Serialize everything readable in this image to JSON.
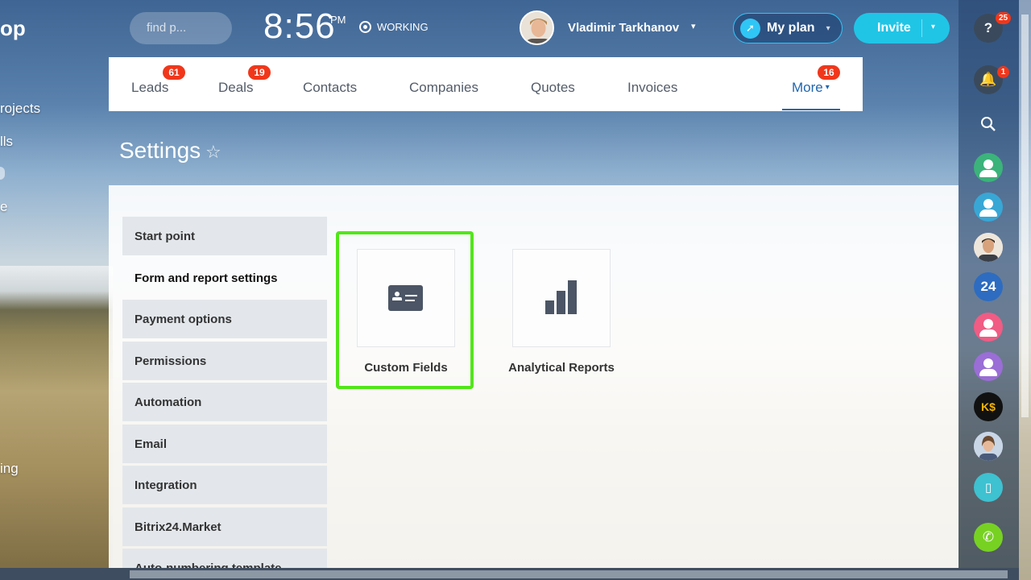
{
  "left_sidebar": {
    "logo_fragment": "op",
    "items": [
      "rojects",
      "lls",
      "e",
      "ing"
    ]
  },
  "header": {
    "search_placeholder": "find p...",
    "time": "8:56",
    "ampm": "PM",
    "status": "WORKING",
    "user_name": "Vladimir Tarkhanov",
    "my_plan_label": "My plan",
    "invite_label": "Invite"
  },
  "tabs": [
    {
      "label": "Leads",
      "badge": "61"
    },
    {
      "label": "Deals",
      "badge": "19"
    },
    {
      "label": "Contacts",
      "badge": ""
    },
    {
      "label": "Companies",
      "badge": ""
    },
    {
      "label": "Quotes",
      "badge": ""
    },
    {
      "label": "Invoices",
      "badge": ""
    },
    {
      "label": "More",
      "badge": "16"
    }
  ],
  "page_title": "Settings",
  "settings_menu": [
    "Start point",
    "Form and report settings",
    "Payment options",
    "Permissions",
    "Automation",
    "Email",
    "Integration",
    "Bitrix24.Market",
    "Auto-numbering template"
  ],
  "cards": [
    {
      "label": "Custom Fields",
      "icon": "id-card-icon"
    },
    {
      "label": "Analytical Reports",
      "icon": "bar-chart-icon"
    }
  ],
  "right_rail": {
    "help_badge": "25",
    "notifications_badge": "1",
    "bitrix_label": "24",
    "ks_label": "K$"
  },
  "colors": {
    "accent": "#2067b0",
    "badge": "#f0371b",
    "invite": "#20c5e6",
    "highlight": "#52e61a"
  }
}
